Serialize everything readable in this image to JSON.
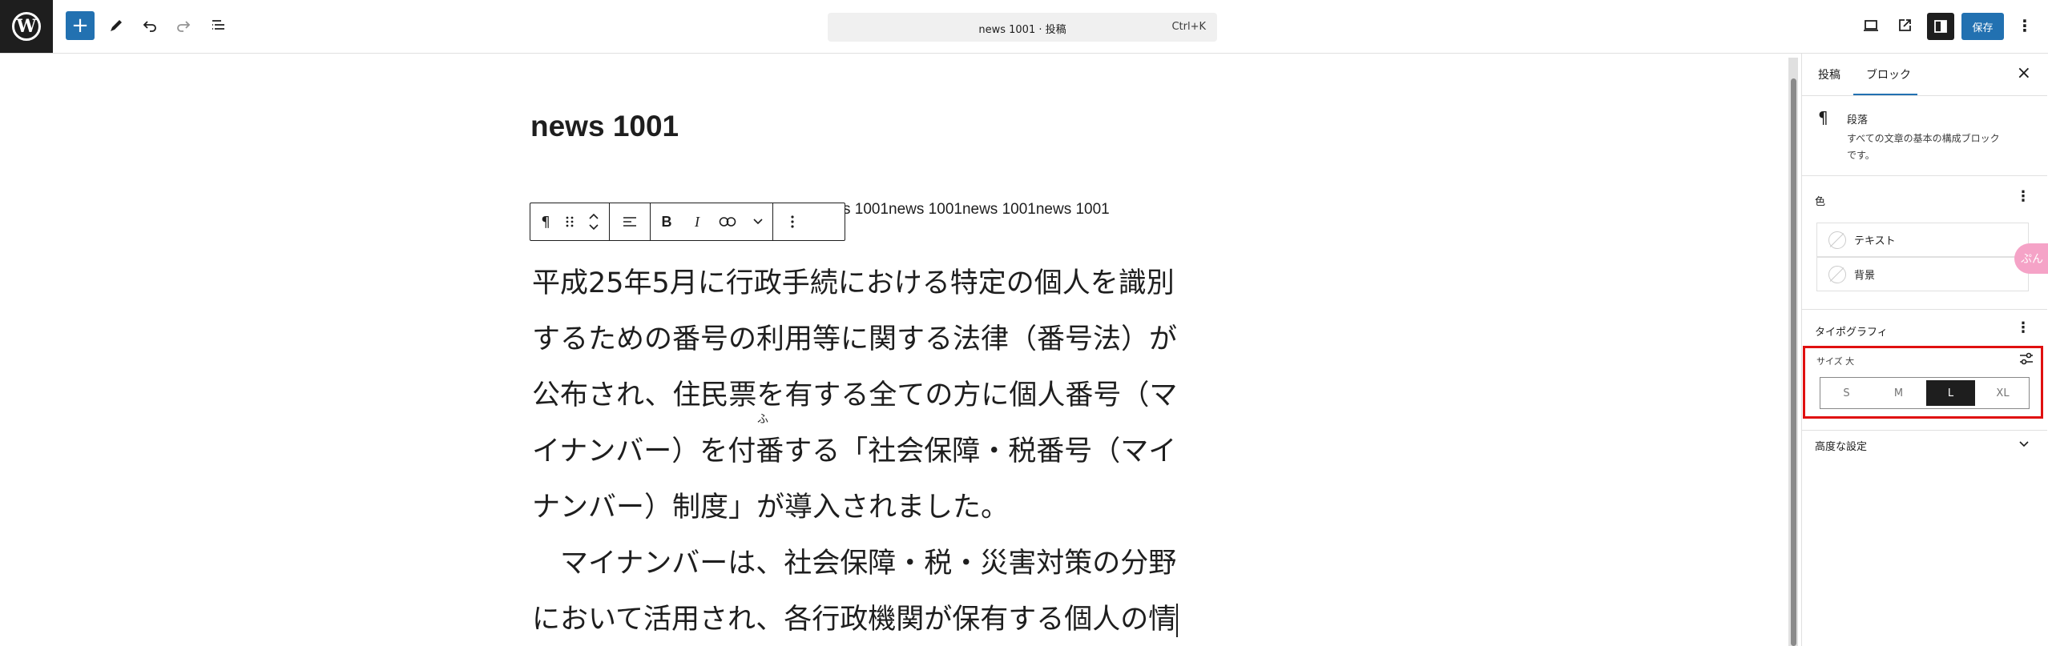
{
  "topbar": {
    "logo": "W",
    "add_label": "+",
    "command": {
      "title": "news 1001 · 投稿",
      "shortcut": "Ctrl+K"
    },
    "save_label": "保存",
    "more_label": "⋮"
  },
  "editor": {
    "title": "news 1001",
    "news_line": "s 1001news 1001news 1001news 1001",
    "toolbar": {
      "paragraph": "¶",
      "bold": "B",
      "italic": "I"
    },
    "paragraph_lines": [
      "平成25年5月に行政手続における特定の個人を識別",
      "するための番号の利用等に関する法律（番号法）が",
      "公布され、住民票を有する全ての方に個人番号（マ",
      "イナンバー）を付番する「社会保障・税番号（マイ",
      "ナンバー）制度」が導入されました。",
      "　マイナンバーは、社会保障・税・災害対策の分野",
      "において活用され、各行政機関が保有する個人の情"
    ],
    "ruby": "ふ"
  },
  "sidebar": {
    "tabs": [
      "投稿",
      "ブロック"
    ],
    "active_tab": "ブロック",
    "close": "×",
    "block": {
      "icon": "¶",
      "name": "段落",
      "description_line1": "すべての文章の基本の構成ブロック",
      "description_line2": "です。"
    },
    "color": {
      "title": "色",
      "items": [
        "テキスト",
        "背景"
      ]
    },
    "typography": {
      "title": "タイポグラフィ",
      "size_label": "サイズ 大",
      "options": [
        "S",
        "M",
        "L",
        "XL"
      ],
      "selected": "L"
    },
    "advanced": {
      "title": "高度な設定"
    },
    "floating_tab": "ぷん"
  },
  "colors": {
    "accent": "#2271b1",
    "dark": "#1e1e1e",
    "highlight": "#e01010"
  }
}
